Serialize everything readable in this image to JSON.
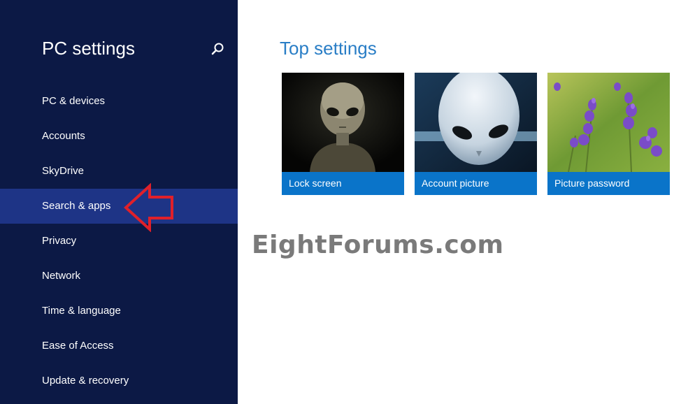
{
  "sidebar": {
    "title": "PC settings",
    "search_icon": "search-icon",
    "items": [
      {
        "label": "PC & devices"
      },
      {
        "label": "Accounts"
      },
      {
        "label": "SkyDrive"
      },
      {
        "label": "Search & apps",
        "selected": true
      },
      {
        "label": "Privacy"
      },
      {
        "label": "Network"
      },
      {
        "label": "Time & language"
      },
      {
        "label": "Ease of Access"
      },
      {
        "label": "Update & recovery"
      }
    ]
  },
  "main": {
    "title": "Top settings",
    "tiles": [
      {
        "label": "Lock screen",
        "image": "alien-portrait"
      },
      {
        "label": "Account picture",
        "image": "alien-head"
      },
      {
        "label": "Picture password",
        "image": "lavender-flowers"
      }
    ]
  },
  "watermark": "EightForums.com",
  "colors": {
    "sidebar_bg": "#0c1945",
    "selected_bg": "#1e3486",
    "accent": "#2a7ec6",
    "tile_label_bg": "#0a74c9",
    "arrow": "#e0202a"
  }
}
